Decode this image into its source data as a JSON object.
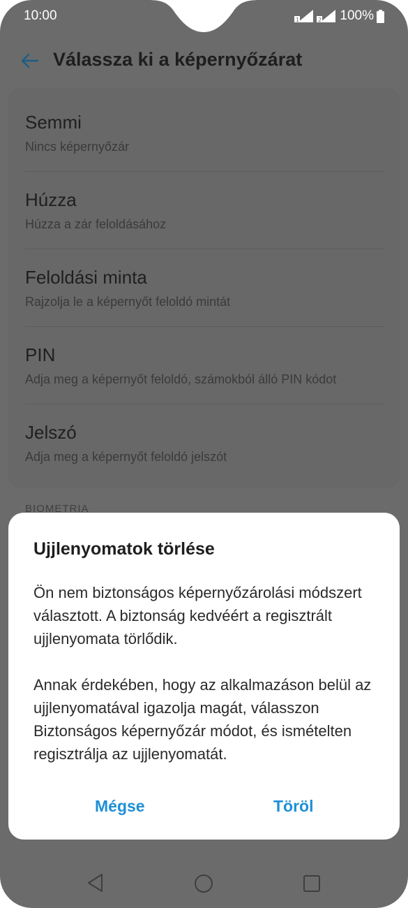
{
  "status_bar": {
    "time": "10:00",
    "battery": "100%",
    "icons": [
      "sim1-signal-icon",
      "sim2-signal-icon",
      "battery-icon"
    ]
  },
  "header": {
    "title": "Válassza ki a képernyőzárat",
    "back_icon": "arrow-left-icon"
  },
  "options": [
    {
      "title": "Semmi",
      "subtitle": "Nincs képernyőzár"
    },
    {
      "title": "Húzza",
      "subtitle": "Húzza a zár feloldásához"
    },
    {
      "title": "Feloldási minta",
      "subtitle": "Rajzolja le a képernyőt feloldó mintát"
    },
    {
      "title": "PIN",
      "subtitle": "Adja meg a képernyőt feloldó, számokból álló PIN kódot"
    },
    {
      "title": "Jelszó",
      "subtitle": "Adja meg a képernyőt feloldó jelszót"
    }
  ],
  "section_label": "BIOMETRIA",
  "dialog": {
    "title": "Ujjlenyomatok törlése",
    "paragraph1": "Ön nem biztonságos képernyőzárolási módszert választott. A biztonság kedvéért a regisztrált ujjlenyomata törlődik.",
    "paragraph2": "Annak érdekében, hogy az alkalmazáson belül az ujjlenyomatával igazolja magát, válasszon Biztonságos képernyőzár módot, és ismételten regisztrálja az ujjlenyomatát.",
    "cancel_label": "Mégse",
    "delete_label": "Töröl"
  },
  "nav_bar": {
    "icons": [
      "nav-back-icon",
      "nav-home-icon",
      "nav-recent-icon"
    ]
  },
  "colors": {
    "accent": "#1e8fd6",
    "scrim": "#6b6b6b",
    "dialog_bg": "#ffffff"
  }
}
